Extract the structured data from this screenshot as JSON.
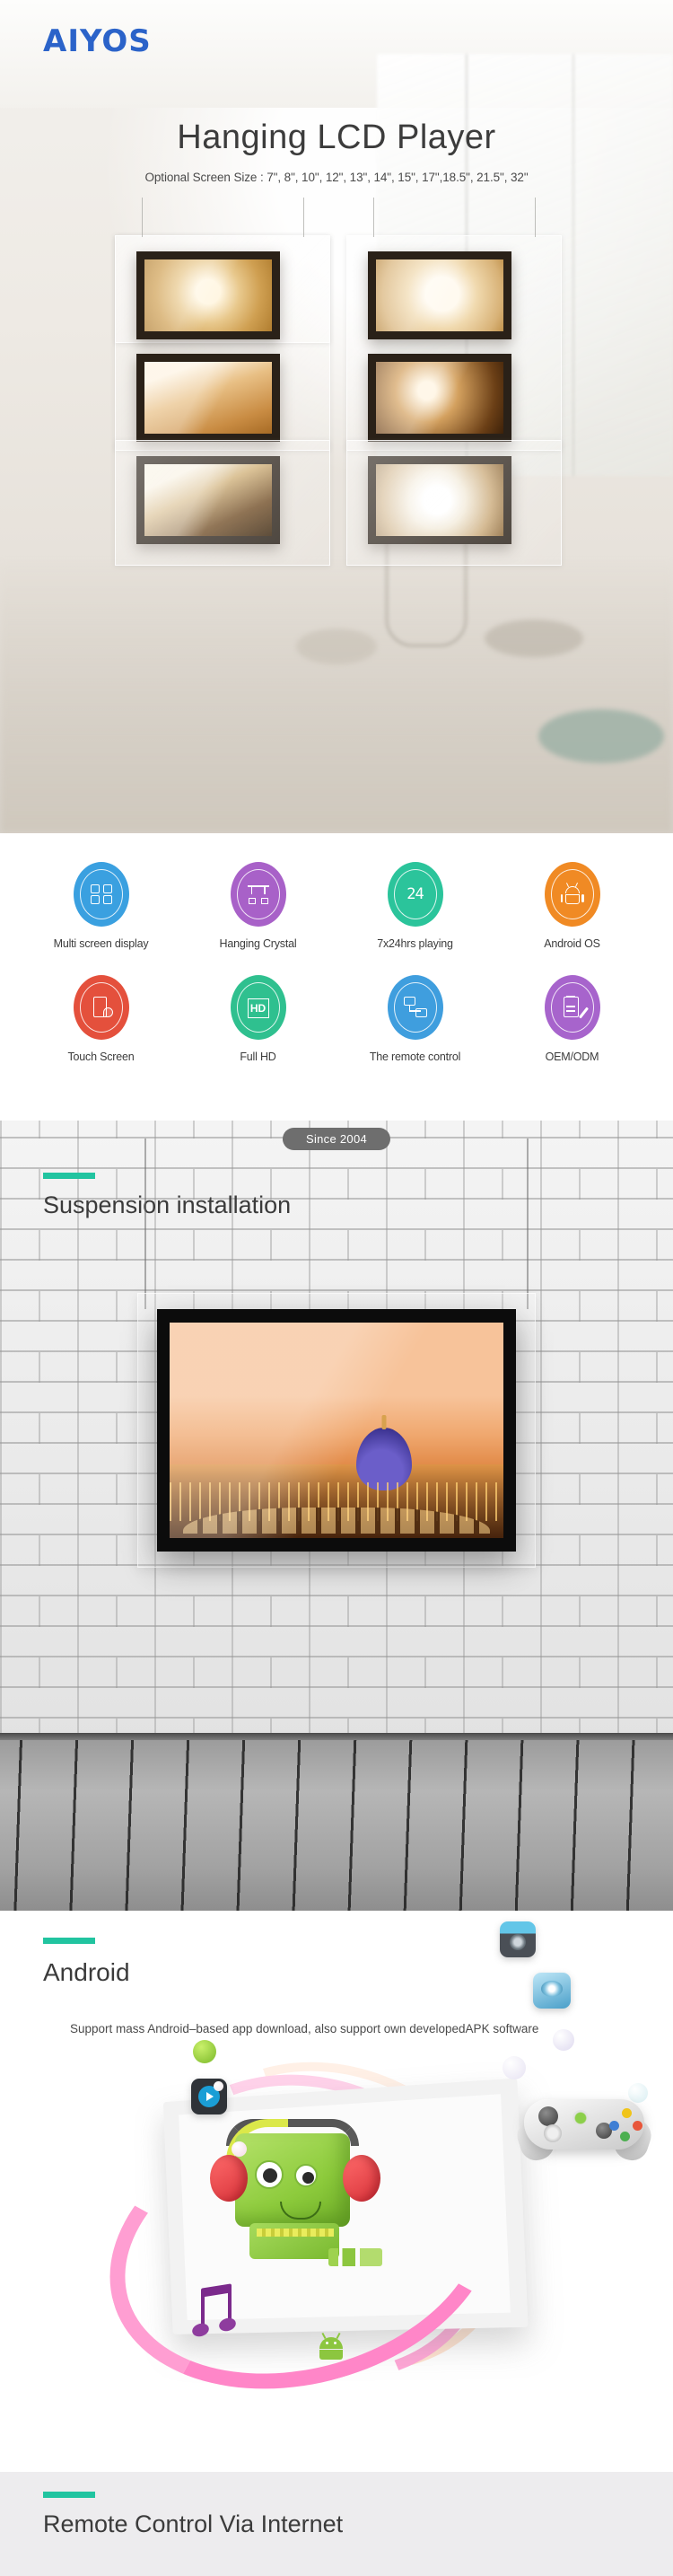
{
  "brand": {
    "logo_text": "AIYOS"
  },
  "hero": {
    "title": "Hanging LCD Player",
    "subtitle": "Optional Screen Size : 7\", 8\", 10\", 12\", 13\", 14\", 15\", 17\",18.5\", 21.5\", 32\"",
    "screen_sizes": [
      "7\"",
      "8\"",
      "10\"",
      "12\"",
      "13\"",
      "14\"",
      "15\"",
      "17\"",
      "18.5\"",
      "21.5\"",
      "32\""
    ],
    "displays": [
      {
        "name": "latte-cup-display"
      },
      {
        "name": "latte-art-display"
      },
      {
        "name": "milk-splash-display"
      },
      {
        "name": "coffee-beans-display"
      },
      {
        "name": "chocolate-cake-display"
      },
      {
        "name": "white-coffee-cup-display"
      }
    ]
  },
  "features": {
    "row1": [
      {
        "label": "Multi screen display",
        "color": "#3aa0e0",
        "icon": "grid-icon"
      },
      {
        "label": "Hanging Crystal",
        "color": "#a861c8",
        "icon": "hanging-crystal-icon"
      },
      {
        "label": "7x24hrs playing",
        "color": "#2bc49b",
        "icon": "twenty-four-icon"
      },
      {
        "label": "Android OS",
        "color": "#f08a24",
        "icon": "android-robot-icon"
      }
    ],
    "row2": [
      {
        "label": "Touch Screen",
        "color": "#e4503c",
        "icon": "touch-hand-icon"
      },
      {
        "label": "Full HD",
        "color": "#2fc08f",
        "icon": "hd-icon"
      },
      {
        "label": "The remote control",
        "color": "#3f9ede",
        "icon": "remote-network-icon"
      },
      {
        "label": "OEM/ODM",
        "color": "#a764cc",
        "icon": "document-pencil-icon"
      }
    ]
  },
  "suspension": {
    "badge": "Since 2004",
    "title": "Suspension installation",
    "accent_color": "#21c4a0",
    "display_content": "st-peters-basilica-sunset"
  },
  "android": {
    "title": "Android",
    "body": "Support mass Android–based app download, also support own developedAPK software",
    "accent_color": "#21c4a0",
    "icons": [
      "camera-app-icon",
      "bluray-disc-icon",
      "media-play-icon",
      "green-orb-icon",
      "gamepad-icon",
      "music-note-icon",
      "android-mascot-icon"
    ]
  },
  "remote": {
    "title": "Remote Control Via Internet",
    "accent_color": "#21c4a0"
  }
}
